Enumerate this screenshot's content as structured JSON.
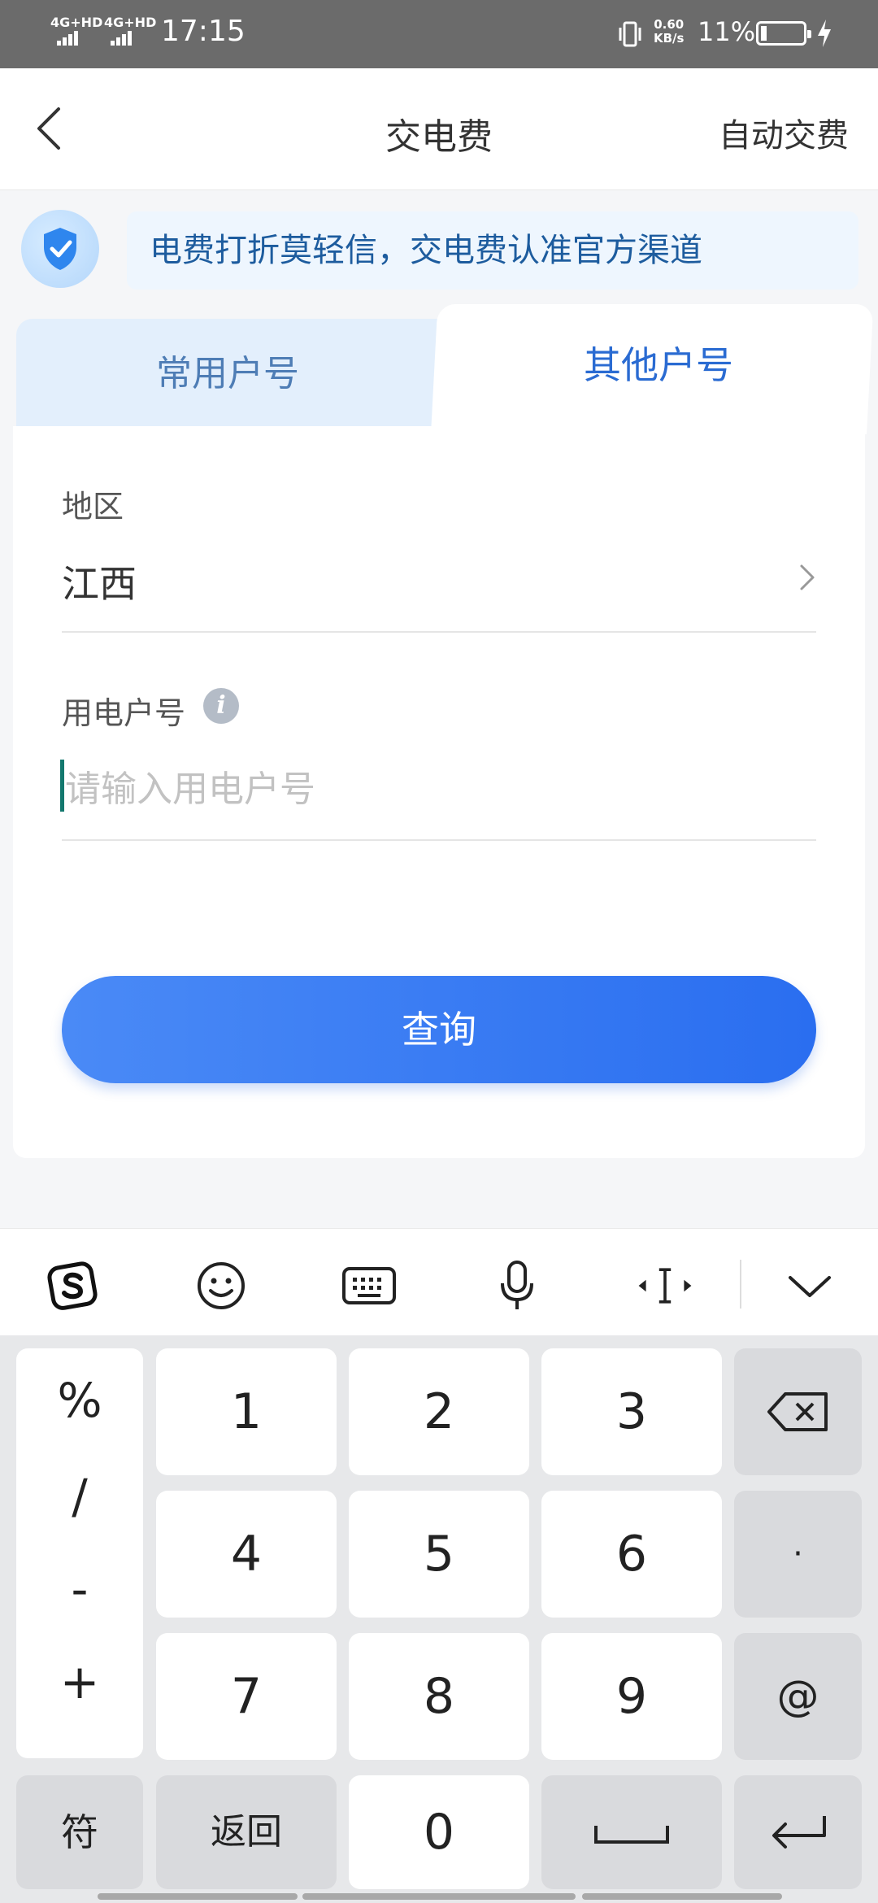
{
  "status_bar": {
    "sim1": "4G+HD",
    "sim2": "4G+HD",
    "time": "17:15",
    "net_speed_value": "0.60",
    "net_speed_unit": "KB/s",
    "battery": "11%",
    "battery_level": 0.11,
    "icons": [
      "signal-icon",
      "vibrate-icon",
      "battery-icon",
      "charging-bolt-icon"
    ]
  },
  "header": {
    "title": "交电费",
    "right_action": "自动交费",
    "back_icon": "chevron-left-icon"
  },
  "notice": {
    "text": "电费打折莫轻信，交电费认准官方渠道",
    "icon": "shield-check-icon"
  },
  "tabs": [
    {
      "label": "常用户号",
      "active": false
    },
    {
      "label": "其他户号",
      "active": true
    }
  ],
  "form": {
    "region_label": "地区",
    "region_value": "江西",
    "account_label": "用电户号",
    "account_info_icon": "i",
    "account_placeholder": "请输入用电户号",
    "account_value": "",
    "submit_label": "查询"
  },
  "keyboard": {
    "toolbar": [
      "sogou-logo-icon",
      "emoji-icon",
      "keyboard-icon",
      "microphone-icon",
      "cursor-move-icon",
      "collapse-chevron-icon"
    ],
    "symbols": [
      "%",
      "/",
      "-",
      "+"
    ],
    "rows": [
      [
        "1",
        "2",
        "3"
      ],
      [
        "4",
        "5",
        "6"
      ],
      [
        "7",
        "8",
        "9"
      ]
    ],
    "right_keys": [
      "backspace-icon",
      "·",
      "@"
    ],
    "bottom": {
      "symbols_label": "符",
      "back_label": "返回",
      "zero": "0",
      "space_icon": "space-icon",
      "enter_icon": "enter-icon"
    }
  },
  "colors": {
    "accent": "#2a6bd2",
    "button_gradient_start": "#4a8af6",
    "button_gradient_end": "#2a6ef0",
    "notice_bg": "#eef6fe",
    "notice_text": "#1d5c9e",
    "caret": "#13786e"
  }
}
